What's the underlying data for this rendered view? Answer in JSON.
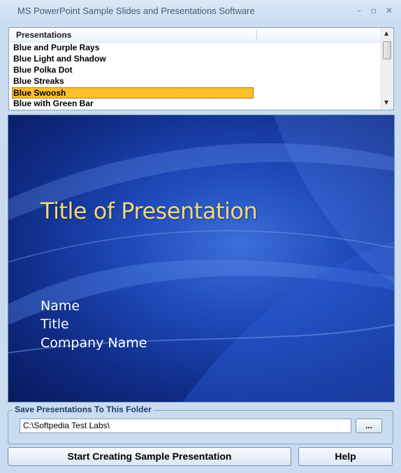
{
  "window": {
    "title": "MS PowerPoint Sample Slides and Presentations Software",
    "minimize_glyph": "–",
    "maximize_glyph": "▫",
    "close_glyph": "✕"
  },
  "presentations": {
    "header": "Presentations",
    "items": [
      "Blue and Purple Rays",
      "Blue Light and Shadow",
      "Blue Polka Dot",
      "Blue Streaks",
      "Blue Swoosh",
      "Blue with Green Bar"
    ],
    "selected_index": 4
  },
  "preview": {
    "title": "Title of Presentation",
    "lines": [
      "Name",
      "Title",
      "Company Name"
    ]
  },
  "save": {
    "label": "Save Presentations To This Folder",
    "path": "C:\\Softpedia Test Labs\\",
    "browse_label": "..."
  },
  "buttons": {
    "start_label": "Start Creating Sample Presentation",
    "help_label": "Help"
  }
}
